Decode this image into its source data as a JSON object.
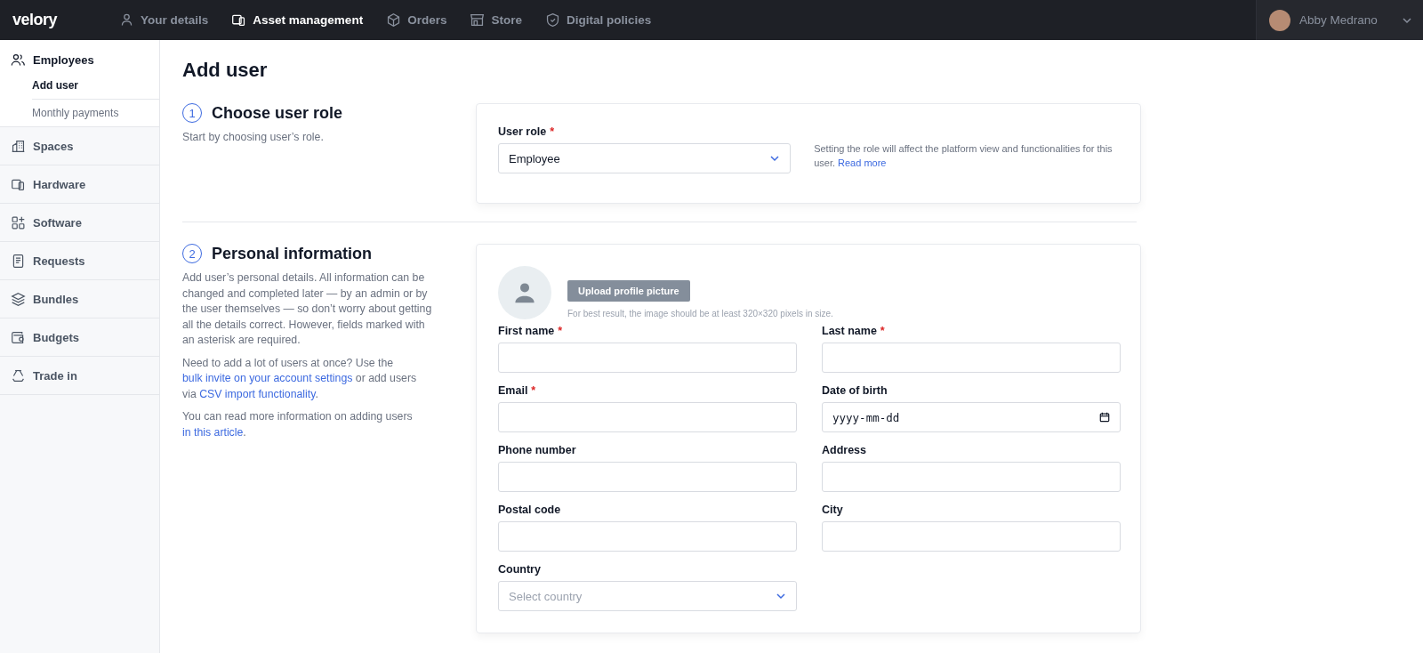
{
  "topbar": {
    "logo": "velory",
    "nav": [
      {
        "label": "Your details",
        "selected": false
      },
      {
        "label": "Asset management",
        "selected": true
      },
      {
        "label": "Orders",
        "selected": false
      },
      {
        "label": "Store",
        "selected": false
      },
      {
        "label": "Digital policies",
        "selected": false
      }
    ],
    "user": {
      "name": "Abby Medrano"
    }
  },
  "sidebar": {
    "items": [
      {
        "label": "Employees",
        "expanded": true,
        "children": [
          {
            "label": "Add user",
            "selected": true
          },
          {
            "label": "Monthly payments",
            "selected": false
          }
        ]
      },
      {
        "label": "Spaces",
        "expanded": false
      },
      {
        "label": "Hardware",
        "expanded": false
      },
      {
        "label": "Software",
        "expanded": false
      },
      {
        "label": "Requests",
        "expanded": false
      },
      {
        "label": "Bundles",
        "expanded": false
      },
      {
        "label": "Budgets",
        "expanded": false
      },
      {
        "label": "Trade in",
        "expanded": false
      }
    ]
  },
  "page": {
    "title": "Add user"
  },
  "sections": [
    {
      "number": "1",
      "title": "Choose user role",
      "paragraphs": [
        [
          {
            "kind": "text",
            "text": "Start by choosing user’s role."
          }
        ]
      ],
      "kind": "role",
      "field": {
        "label": "User role",
        "required_mark": "*",
        "value": "Employee"
      },
      "help": [
        {
          "kind": "text",
          "text": "Setting the role will affect the platform view and functionalities for this user. "
        },
        {
          "kind": "link",
          "text": "Read more"
        }
      ]
    },
    {
      "number": "2",
      "title": "Personal information",
      "paragraphs": [
        [
          {
            "kind": "text",
            "text": "Add user’s personal details. All information can be changed and completed later — by an admin or by the user themselves — so don’t worry about getting all the details correct. However, fields marked with an asterisk are required."
          }
        ],
        [
          {
            "kind": "text",
            "text": "Need to add a lot of users at once? Use the "
          },
          {
            "kind": "link",
            "text": "bulk invite on your account settings"
          },
          {
            "kind": "text",
            "text": " or add users via "
          },
          {
            "kind": "link",
            "text": "CSV import functionality"
          },
          {
            "kind": "text",
            "text": "."
          }
        ],
        [
          {
            "kind": "text",
            "text": "You can read more information on adding users "
          },
          {
            "kind": "link",
            "text": "in this article"
          },
          {
            "kind": "text",
            "text": "."
          }
        ]
      ],
      "kind": "personal",
      "upload": {
        "button": "Upload profile picture",
        "hint": "For best result, the image should be at least 320×320 pixels in size."
      },
      "fields": [
        {
          "label": "First name",
          "required_mark": "*",
          "kind": "text"
        },
        {
          "label": "Last name",
          "required_mark": "*",
          "kind": "text"
        },
        {
          "label": "Email",
          "required_mark": "*",
          "kind": "text"
        },
        {
          "label": "Date of birth",
          "kind": "date",
          "placeholder": "yyyy-mm-dd"
        },
        {
          "label": "Phone number",
          "kind": "text"
        },
        {
          "label": "Address",
          "kind": "text"
        },
        {
          "label": "Postal code",
          "kind": "text"
        },
        {
          "label": "City",
          "kind": "text"
        },
        {
          "label": "Country",
          "kind": "select",
          "placeholder": "Select country"
        }
      ]
    }
  ]
}
